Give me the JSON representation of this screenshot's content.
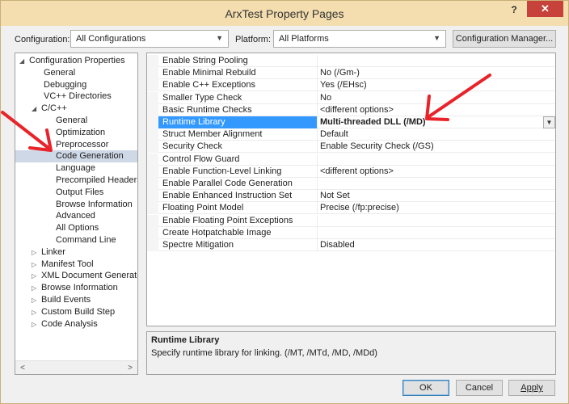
{
  "window": {
    "title": "ArxTest Property Pages",
    "help": "?",
    "close": "✕"
  },
  "config": {
    "configuration_label": "Configuration:",
    "configuration_value": "All Configurations",
    "platform_label": "Platform:",
    "platform_value": "All Platforms",
    "manager_button": "Configuration Manager..."
  },
  "tree": {
    "items": [
      {
        "label": "Configuration Properties",
        "expander": "◢"
      },
      {
        "label": "General"
      },
      {
        "label": "Debugging"
      },
      {
        "label": "VC++ Directories"
      },
      {
        "label": "C/C++",
        "expander": "◢"
      },
      {
        "label": "General"
      },
      {
        "label": "Optimization"
      },
      {
        "label": "Preprocessor"
      },
      {
        "label": "Code Generation",
        "selected": true
      },
      {
        "label": "Language"
      },
      {
        "label": "Precompiled Headers"
      },
      {
        "label": "Output Files"
      },
      {
        "label": "Browse Information"
      },
      {
        "label": "Advanced"
      },
      {
        "label": "All Options"
      },
      {
        "label": "Command Line"
      },
      {
        "label": "Linker",
        "expander": "▷"
      },
      {
        "label": "Manifest Tool",
        "expander": "▷"
      },
      {
        "label": "XML Document Generator",
        "expander": "▷"
      },
      {
        "label": "Browse Information",
        "expander": "▷"
      },
      {
        "label": "Build Events",
        "expander": "▷"
      },
      {
        "label": "Custom Build Step",
        "expander": "▷"
      },
      {
        "label": "Code Analysis",
        "expander": "▷"
      }
    ],
    "scroll_left": "<",
    "scroll_right": ">"
  },
  "properties": [
    {
      "name": "Enable String Pooling",
      "value": ""
    },
    {
      "name": "Enable Minimal Rebuild",
      "value": "No (/Gm-)"
    },
    {
      "name": "Enable C++ Exceptions",
      "value": "Yes (/EHsc)"
    },
    {
      "name": "Smaller Type Check",
      "value": "No"
    },
    {
      "name": "Basic Runtime Checks",
      "value": "<different options>"
    },
    {
      "name": "Runtime Library",
      "value": "Multi-threaded DLL (/MD)",
      "selected": true
    },
    {
      "name": "Struct Member Alignment",
      "value": "Default"
    },
    {
      "name": "Security Check",
      "value": "Enable Security Check (/GS)"
    },
    {
      "name": "Control Flow Guard",
      "value": ""
    },
    {
      "name": "Enable Function-Level Linking",
      "value": "<different options>"
    },
    {
      "name": "Enable Parallel Code Generation",
      "value": ""
    },
    {
      "name": "Enable Enhanced Instruction Set",
      "value": "Not Set"
    },
    {
      "name": "Floating Point Model",
      "value": "Precise (/fp:precise)"
    },
    {
      "name": "Enable Floating Point Exceptions",
      "value": ""
    },
    {
      "name": "Create Hotpatchable Image",
      "value": ""
    },
    {
      "name": "Spectre Mitigation",
      "value": "Disabled"
    }
  ],
  "description": {
    "title": "Runtime Library",
    "text": "Specify runtime library for linking.    (/MT, /MTd, /MD, /MDd)"
  },
  "buttons": {
    "ok": "OK",
    "cancel": "Cancel",
    "apply": "Apply"
  },
  "colors": {
    "titlebar": "#f4deaf",
    "close": "#c7423a",
    "selection": "#3399ff",
    "annotation_arrow": "#e8232a"
  },
  "icons": {
    "dropdown": "chevron-down-icon",
    "tree_expanded": "triangle-down-icon",
    "tree_collapsed": "triangle-right-icon"
  }
}
